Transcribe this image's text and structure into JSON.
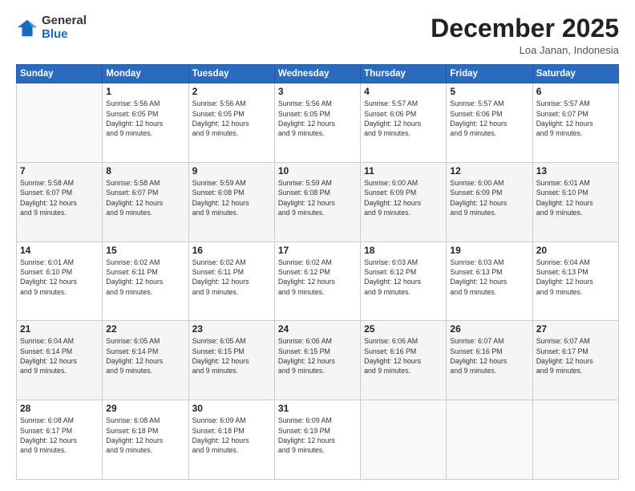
{
  "logo": {
    "general": "General",
    "blue": "Blue"
  },
  "header": {
    "month": "December 2025",
    "location": "Loa Janan, Indonesia"
  },
  "weekdays": [
    "Sunday",
    "Monday",
    "Tuesday",
    "Wednesday",
    "Thursday",
    "Friday",
    "Saturday"
  ],
  "weeks": [
    [
      {
        "num": "",
        "info": ""
      },
      {
        "num": "1",
        "info": "Sunrise: 5:56 AM\nSunset: 6:05 PM\nDaylight: 12 hours\nand 9 minutes."
      },
      {
        "num": "2",
        "info": "Sunrise: 5:56 AM\nSunset: 6:05 PM\nDaylight: 12 hours\nand 9 minutes."
      },
      {
        "num": "3",
        "info": "Sunrise: 5:56 AM\nSunset: 6:05 PM\nDaylight: 12 hours\nand 9 minutes."
      },
      {
        "num": "4",
        "info": "Sunrise: 5:57 AM\nSunset: 6:06 PM\nDaylight: 12 hours\nand 9 minutes."
      },
      {
        "num": "5",
        "info": "Sunrise: 5:57 AM\nSunset: 6:06 PM\nDaylight: 12 hours\nand 9 minutes."
      },
      {
        "num": "6",
        "info": "Sunrise: 5:57 AM\nSunset: 6:07 PM\nDaylight: 12 hours\nand 9 minutes."
      }
    ],
    [
      {
        "num": "7",
        "info": "Sunrise: 5:58 AM\nSunset: 6:07 PM\nDaylight: 12 hours\nand 9 minutes."
      },
      {
        "num": "8",
        "info": "Sunrise: 5:58 AM\nSunset: 6:07 PM\nDaylight: 12 hours\nand 9 minutes."
      },
      {
        "num": "9",
        "info": "Sunrise: 5:59 AM\nSunset: 6:08 PM\nDaylight: 12 hours\nand 9 minutes."
      },
      {
        "num": "10",
        "info": "Sunrise: 5:59 AM\nSunset: 6:08 PM\nDaylight: 12 hours\nand 9 minutes."
      },
      {
        "num": "11",
        "info": "Sunrise: 6:00 AM\nSunset: 6:09 PM\nDaylight: 12 hours\nand 9 minutes."
      },
      {
        "num": "12",
        "info": "Sunrise: 6:00 AM\nSunset: 6:09 PM\nDaylight: 12 hours\nand 9 minutes."
      },
      {
        "num": "13",
        "info": "Sunrise: 6:01 AM\nSunset: 6:10 PM\nDaylight: 12 hours\nand 9 minutes."
      }
    ],
    [
      {
        "num": "14",
        "info": "Sunrise: 6:01 AM\nSunset: 6:10 PM\nDaylight: 12 hours\nand 9 minutes."
      },
      {
        "num": "15",
        "info": "Sunrise: 6:02 AM\nSunset: 6:11 PM\nDaylight: 12 hours\nand 9 minutes."
      },
      {
        "num": "16",
        "info": "Sunrise: 6:02 AM\nSunset: 6:11 PM\nDaylight: 12 hours\nand 9 minutes."
      },
      {
        "num": "17",
        "info": "Sunrise: 6:02 AM\nSunset: 6:12 PM\nDaylight: 12 hours\nand 9 minutes."
      },
      {
        "num": "18",
        "info": "Sunrise: 6:03 AM\nSunset: 6:12 PM\nDaylight: 12 hours\nand 9 minutes."
      },
      {
        "num": "19",
        "info": "Sunrise: 6:03 AM\nSunset: 6:13 PM\nDaylight: 12 hours\nand 9 minutes."
      },
      {
        "num": "20",
        "info": "Sunrise: 6:04 AM\nSunset: 6:13 PM\nDaylight: 12 hours\nand 9 minutes."
      }
    ],
    [
      {
        "num": "21",
        "info": "Sunrise: 6:04 AM\nSunset: 6:14 PM\nDaylight: 12 hours\nand 9 minutes."
      },
      {
        "num": "22",
        "info": "Sunrise: 6:05 AM\nSunset: 6:14 PM\nDaylight: 12 hours\nand 9 minutes."
      },
      {
        "num": "23",
        "info": "Sunrise: 6:05 AM\nSunset: 6:15 PM\nDaylight: 12 hours\nand 9 minutes."
      },
      {
        "num": "24",
        "info": "Sunrise: 6:06 AM\nSunset: 6:15 PM\nDaylight: 12 hours\nand 9 minutes."
      },
      {
        "num": "25",
        "info": "Sunrise: 6:06 AM\nSunset: 6:16 PM\nDaylight: 12 hours\nand 9 minutes."
      },
      {
        "num": "26",
        "info": "Sunrise: 6:07 AM\nSunset: 6:16 PM\nDaylight: 12 hours\nand 9 minutes."
      },
      {
        "num": "27",
        "info": "Sunrise: 6:07 AM\nSunset: 6:17 PM\nDaylight: 12 hours\nand 9 minutes."
      }
    ],
    [
      {
        "num": "28",
        "info": "Sunrise: 6:08 AM\nSunset: 6:17 PM\nDaylight: 12 hours\nand 9 minutes."
      },
      {
        "num": "29",
        "info": "Sunrise: 6:08 AM\nSunset: 6:18 PM\nDaylight: 12 hours\nand 9 minutes."
      },
      {
        "num": "30",
        "info": "Sunrise: 6:09 AM\nSunset: 6:18 PM\nDaylight: 12 hours\nand 9 minutes."
      },
      {
        "num": "31",
        "info": "Sunrise: 6:09 AM\nSunset: 6:19 PM\nDaylight: 12 hours\nand 9 minutes."
      },
      {
        "num": "",
        "info": ""
      },
      {
        "num": "",
        "info": ""
      },
      {
        "num": "",
        "info": ""
      }
    ]
  ]
}
